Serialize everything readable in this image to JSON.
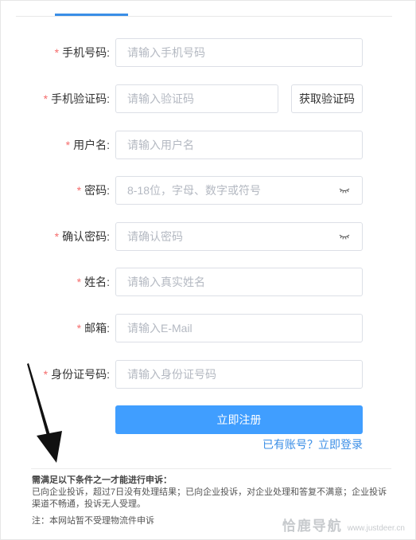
{
  "form": {
    "required_mark": "*",
    "fields": [
      {
        "label": "手机号码:",
        "placeholder": "请输入手机号码"
      },
      {
        "label": "手机验证码:",
        "placeholder": "请输入验证码",
        "button": "获取验证码"
      },
      {
        "label": "用户名:",
        "placeholder": "请输入用户名"
      },
      {
        "label": "密码:",
        "placeholder": "8-18位，字母、数字或符号"
      },
      {
        "label": "确认密码:",
        "placeholder": "请确认密码"
      },
      {
        "label": "姓名:",
        "placeholder": "请输入真实姓名"
      },
      {
        "label": "邮箱:",
        "placeholder": "请输入E-Mail"
      },
      {
        "label": "身份证号码:",
        "placeholder": "请输入身份证号码"
      }
    ],
    "submit_label": "立即注册",
    "login_link": "已有账号？立即登录"
  },
  "notice": {
    "title": "需满足以下条件之一才能进行申诉：",
    "body": "已向企业投诉，超过7日没有处理结果；已向企业投诉，对企业处理和答复不满意；企业投诉渠道不畅通，投诉无人受理。",
    "note": "注：本网站暂不受理物流件申诉"
  },
  "watermark": {
    "name": "恰鹿导航",
    "url": "www.justdeer.cn"
  },
  "colors": {
    "primary": "#409eff",
    "link": "#3a8ee6",
    "required": "#f56c6c",
    "border": "#dcdfe6",
    "arrow": "#111111"
  },
  "icons": {
    "password_toggle": "eye-closed-icon",
    "annotation": "arrow-pointer-icon"
  }
}
